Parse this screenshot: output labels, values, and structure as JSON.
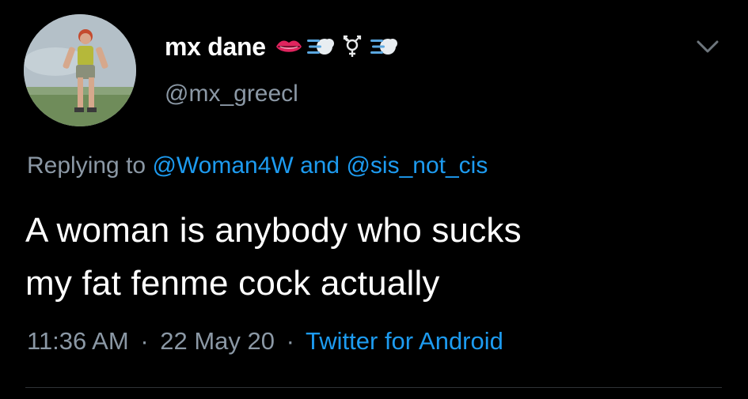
{
  "tweet": {
    "display_name": "mx dane",
    "handle": "@mx_greecl",
    "name_emojis": [
      "lips-icon",
      "dash-icon",
      "transgender-symbol-icon",
      "dash-icon"
    ],
    "replying_prefix": "Replying to",
    "reply_mention_1": "@Woman4W",
    "reply_and": "and",
    "reply_mention_2": "@sis_not_cis",
    "text_line_1": "A woman is anybody who sucks",
    "text_line_2": "my fat fenme cock actually",
    "time": "11:36 AM",
    "separator": "·",
    "date": "22 May 20",
    "source": "Twitter for Android"
  },
  "colors": {
    "background": "#000000",
    "primary_text": "#ffffff",
    "secondary_text": "#8b98a5",
    "link": "#1d9bf0",
    "divider": "#2f3336"
  }
}
